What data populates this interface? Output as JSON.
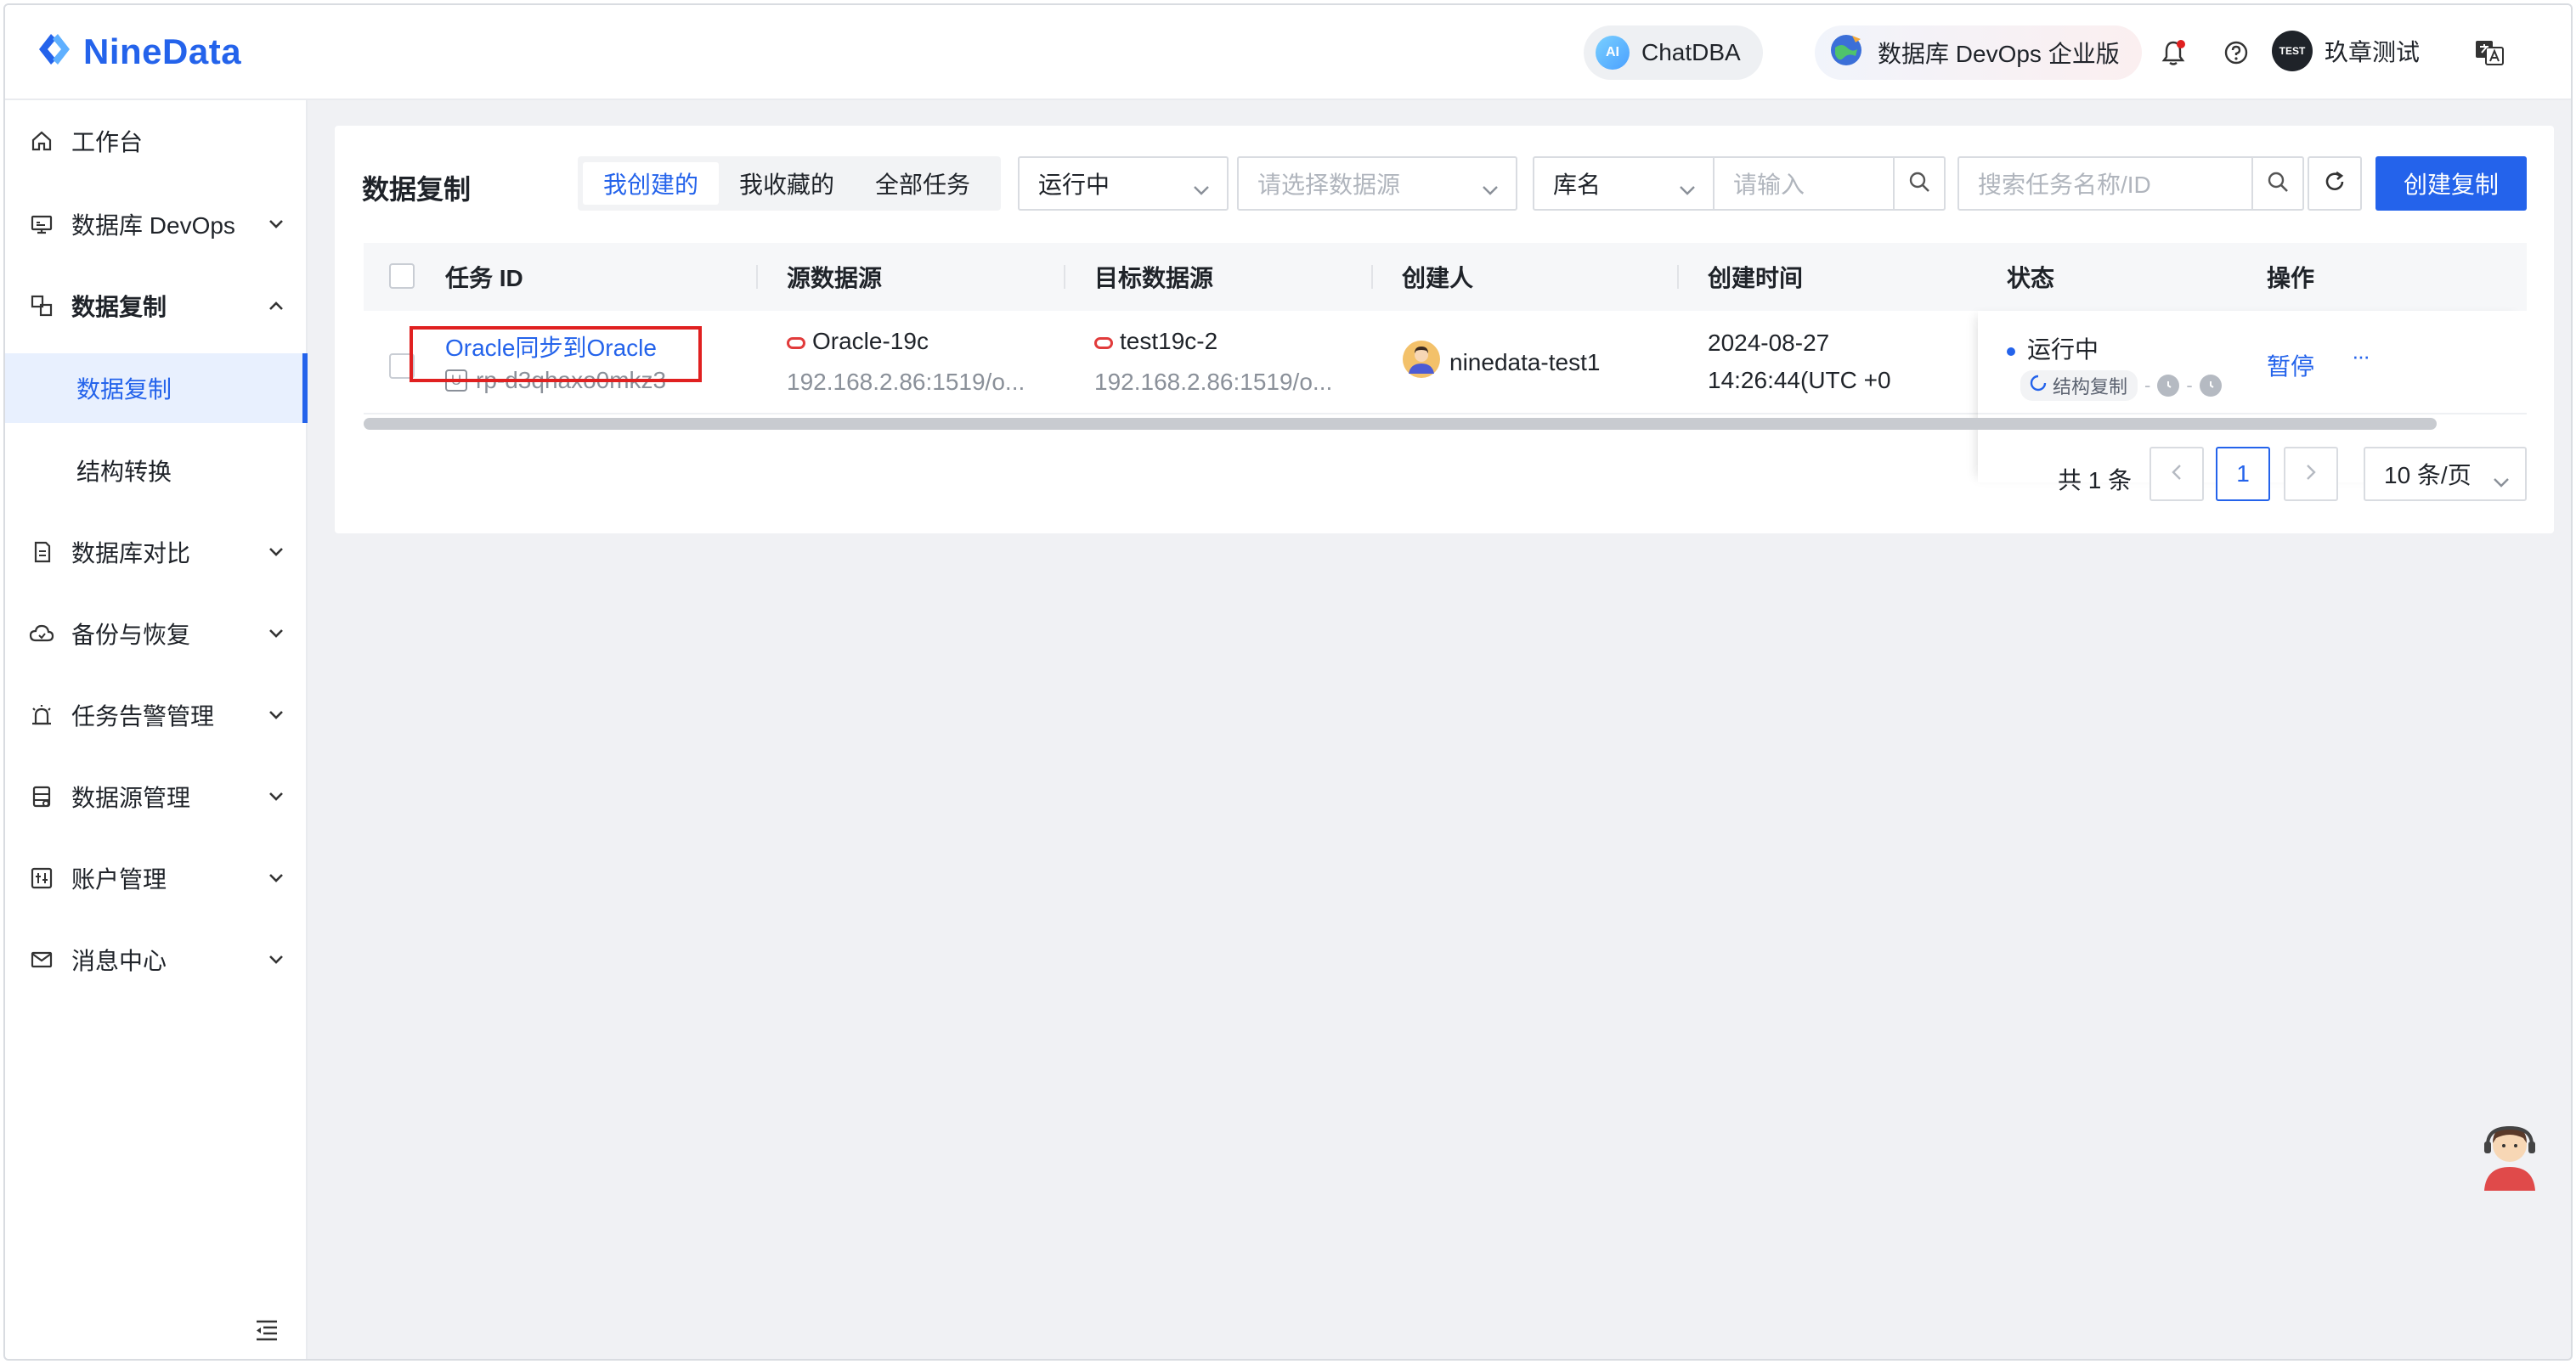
{
  "header": {
    "logo_text": "NineData",
    "chatdba_label": "ChatDBA",
    "ai_badge": "AI",
    "devops_label": "数据库 DevOps 企业版",
    "user_badge": "TEST",
    "user_name": "玖章测试",
    "icons": [
      "bell-icon",
      "help-icon",
      "translate-icon"
    ]
  },
  "sidebar": {
    "items": [
      {
        "label": "工作台",
        "icon": "home-icon"
      },
      {
        "label": "数据库 DevOps",
        "icon": "monitor-icon"
      },
      {
        "label": "数据复制",
        "icon": "replicate-icon"
      },
      {
        "label": "数据复制"
      },
      {
        "label": "结构转换"
      },
      {
        "label": "数据库对比",
        "icon": "compare-icon"
      },
      {
        "label": "备份与恢复",
        "icon": "cloud-icon"
      },
      {
        "label": "任务告警管理",
        "icon": "alarm-icon"
      },
      {
        "label": "数据源管理",
        "icon": "datasource-icon"
      },
      {
        "label": "账户管理",
        "icon": "account-icon"
      },
      {
        "label": "消息中心",
        "icon": "mail-icon"
      }
    ]
  },
  "main": {
    "title": "数据复制",
    "tabs": [
      {
        "label": "我创建的",
        "active": true
      },
      {
        "label": "我收藏的",
        "active": false
      },
      {
        "label": "全部任务",
        "active": false
      }
    ],
    "filters": {
      "status_value": "运行中",
      "datasource_placeholder": "请选择数据源",
      "db_field": "库名",
      "db_input_placeholder": "请输入",
      "task_search_placeholder": "搜索任务名称/ID"
    },
    "create_button": "创建复制",
    "table": {
      "columns": [
        "任务 ID",
        "源数据源",
        "目标数据源",
        "创建人",
        "创建时间",
        "状态",
        "操作"
      ],
      "rows": [
        {
          "task_name": "Oracle同步到Oracle",
          "task_id": "rp-d3qhaxo0mkz3",
          "task_type_badge": "U",
          "source_name": "Oracle-19c",
          "source_addr": "192.168.2.86:1519/o...",
          "target_name": "test19c-2",
          "target_addr": "192.168.2.86:1519/o...",
          "creator": "ninedata-test1",
          "created_date": "2024-08-27",
          "created_time": "14:26:44(UTC +0",
          "status": "运行中",
          "stage": "结构复制",
          "action_pause": "暂停",
          "action_more": "···"
        }
      ]
    },
    "pagination": {
      "total": "共 1 条",
      "current_page": "1",
      "page_size": "10 条/页"
    }
  },
  "colors": {
    "primary": "#2463eb",
    "highlight": "#e02020",
    "oracle": "#e13b3b"
  }
}
